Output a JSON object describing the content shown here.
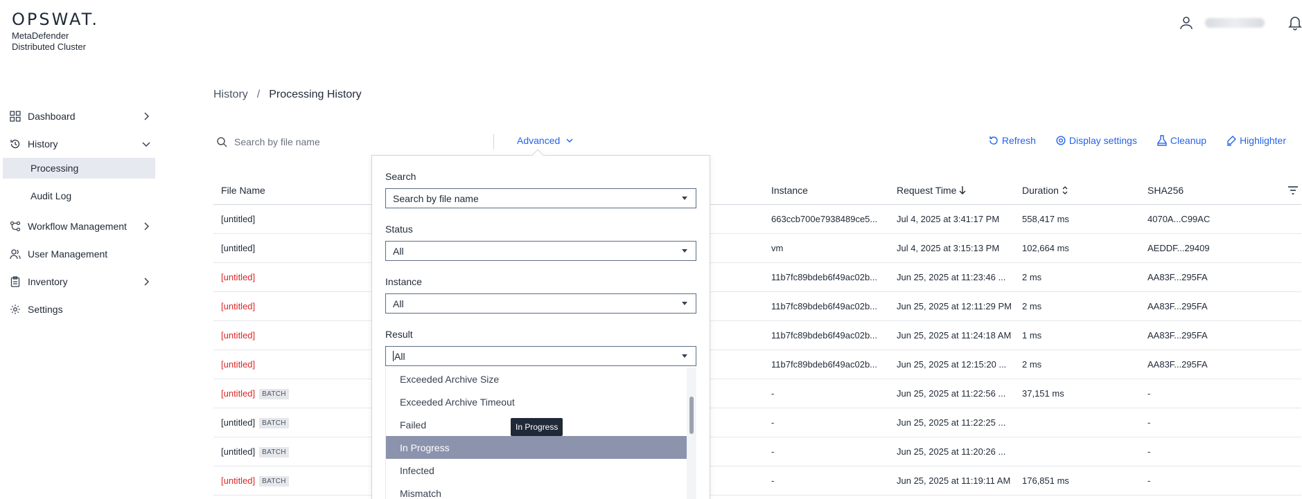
{
  "brand": {
    "logo_text": "OPSWAT.",
    "product_line1": "MetaDefender",
    "product_line2": "Distributed Cluster"
  },
  "header": {
    "user_name": "(blurred)"
  },
  "sidebar": {
    "items": [
      {
        "label": "Dashboard",
        "icon": "grid-icon",
        "chevron": "right"
      },
      {
        "label": "History",
        "icon": "history-icon",
        "chevron": "down"
      },
      {
        "label": "Processing",
        "sub": true,
        "active": true
      },
      {
        "label": "Audit Log",
        "sub": true
      },
      {
        "label": "Workflow Management",
        "icon": "workflow-icon",
        "chevron": "right"
      },
      {
        "label": "User Management",
        "icon": "users-icon"
      },
      {
        "label": "Inventory",
        "icon": "clipboard-icon",
        "chevron": "right"
      },
      {
        "label": "Settings",
        "icon": "gear-icon"
      }
    ]
  },
  "breadcrumb": {
    "root": "History",
    "separator": "/",
    "current": "Processing History"
  },
  "toolbar": {
    "search_placeholder": "Search by file name",
    "advanced_label": "Advanced",
    "refresh_label": "Refresh",
    "display_settings_label": "Display settings",
    "cleanup_label": "Cleanup",
    "highlighter_label": "Highlighter"
  },
  "table": {
    "columns": {
      "file_name": "File Name",
      "instance": "Instance",
      "request_time": "Request Time",
      "duration": "Duration",
      "sha256": "SHA256"
    },
    "rows": [
      {
        "file": "[untitled]",
        "red": false,
        "batch": false,
        "instance": "663ccb700e7938489ce5...",
        "time": "Jul 4, 2025 at 3:41:17 PM",
        "duration": "558,417 ms",
        "sha": "4070A...C99AC"
      },
      {
        "file": "[untitled]",
        "red": false,
        "batch": false,
        "instance": "vm",
        "time": "Jul 4, 2025 at 3:15:13 PM",
        "duration": "102,664 ms",
        "sha": "AEDDF...29409"
      },
      {
        "file": "[untitled]",
        "red": true,
        "batch": false,
        "instance": "11b7fc89bdeb6f49ac02b...",
        "time": "Jun 25, 2025 at 11:23:46 ...",
        "duration": "2 ms",
        "sha": "AA83F...295FA"
      },
      {
        "file": "[untitled]",
        "red": true,
        "batch": false,
        "instance": "11b7fc89bdeb6f49ac02b...",
        "time": "Jun 25, 2025 at 12:11:29 PM",
        "duration": "2 ms",
        "sha": "AA83F...295FA"
      },
      {
        "file": "[untitled]",
        "red": true,
        "batch": false,
        "instance": "11b7fc89bdeb6f49ac02b...",
        "time": "Jun 25, 2025 at 11:24:18 AM",
        "duration": "1 ms",
        "sha": "AA83F...295FA"
      },
      {
        "file": "[untitled]",
        "red": true,
        "batch": false,
        "instance": "11b7fc89bdeb6f49ac02b...",
        "time": "Jun 25, 2025 at 12:15:20 ...",
        "duration": "2 ms",
        "sha": "AA83F...295FA"
      },
      {
        "file": "[untitled]",
        "red": true,
        "batch": true,
        "instance": "-",
        "time": "Jun 25, 2025 at 11:22:56 ...",
        "duration": "37,151 ms",
        "sha": "-"
      },
      {
        "file": "[untitled]",
        "red": false,
        "batch": true,
        "instance": "-",
        "time": "Jun 25, 2025 at 11:22:25 ...",
        "duration": "",
        "sha": "-"
      },
      {
        "file": "[untitled]",
        "red": false,
        "batch": true,
        "instance": "-",
        "time": "Jun 25, 2025 at 11:20:26 ...",
        "duration": "",
        "sha": "-"
      },
      {
        "file": "[untitled]",
        "red": true,
        "batch": true,
        "instance": "-",
        "time": "Jun 25, 2025 at 11:19:11 AM",
        "duration": "176,851 ms",
        "sha": "-"
      }
    ],
    "batch_label": "BATCH"
  },
  "advanced_panel": {
    "search_label": "Search",
    "search_value": "Search by file name",
    "status_label": "Status",
    "status_value": "All",
    "instance_label": "Instance",
    "instance_value": "All",
    "result_label": "Result",
    "result_value": "All",
    "result_options": [
      "Exceeded Archive Size",
      "Exceeded Archive Timeout",
      "Failed",
      "In Progress",
      "Infected",
      "Mismatch"
    ],
    "hovered_option": "In Progress",
    "tooltip": "In Progress"
  },
  "colors": {
    "accent": "#2563eb",
    "alert": "#dc2626",
    "hover_option": "#8b93ad",
    "active_nav": "#e6e9ef"
  }
}
